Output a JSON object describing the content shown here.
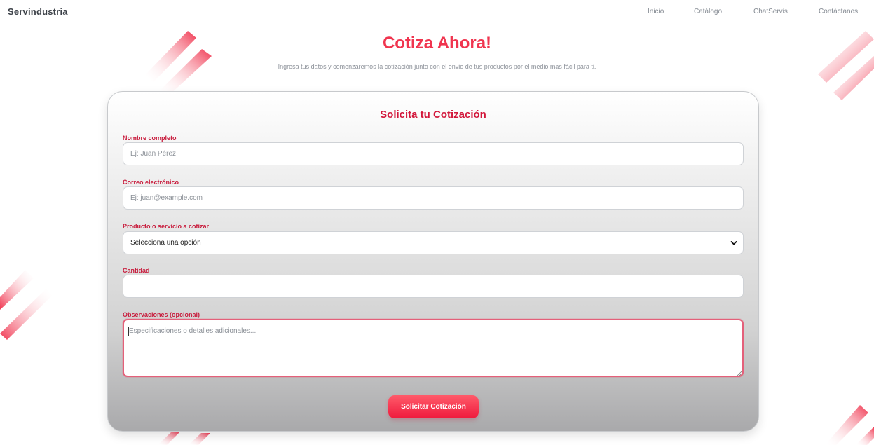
{
  "nav": {
    "brand": "Servindustria",
    "links": [
      "Inicio",
      "Catálogo",
      "ChatServis",
      "Contáctanos"
    ]
  },
  "hero": {
    "title": "Cotiza Ahora!",
    "subtitle": "Ingresa tus datos y comenzaremos la cotización junto con el envio de tus productos por el medio mas fácil para ti."
  },
  "form": {
    "title": "Solicita tu Cotización",
    "name": {
      "label": "Nombre completo",
      "placeholder": "Ej: Juan Pérez"
    },
    "email": {
      "label": "Correo electrónico",
      "placeholder": "Ej: juan@example.com"
    },
    "product": {
      "label": "Producto o servicio a cotizar",
      "selected": "Selecciona una opción"
    },
    "quantity": {
      "label": "Cantidad",
      "placeholder": ""
    },
    "notes": {
      "label": "Observaciones (opcional)",
      "placeholder": "Especificaciones o detalles adicionales..."
    },
    "submit_label": "Solicitar Cotización"
  },
  "colors": {
    "accent": "#f0354f",
    "label": "#c81a3b",
    "brand_text": "#3c4148"
  },
  "icons": {
    "select": "chevron-down-icon",
    "textarea_resize": "resize-grip-icon"
  }
}
